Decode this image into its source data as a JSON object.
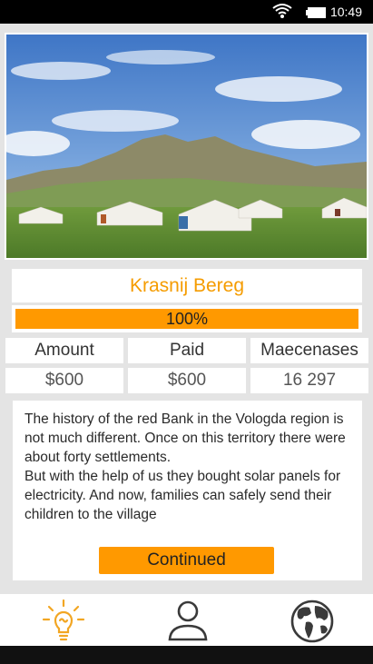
{
  "status_bar": {
    "time": "10:49",
    "icons": [
      "wifi-icon",
      "battery-icon"
    ]
  },
  "project": {
    "image": "landscape-photo-yurts",
    "title": "Krasnij Bereg",
    "progress": {
      "percent": 100,
      "label": "100%"
    },
    "stats": {
      "headers": [
        "Amount",
        "Paid",
        "Maecenases"
      ],
      "values": [
        "$600",
        "$600",
        "16 297"
      ]
    },
    "description": [
      "The history of the red Bank in the Vologda region is not much different. Once on this territory there were about forty settlements.",
      "But with the help of us they bought solar panels for electricity. And now, families can safely send their children to the village"
    ],
    "action_label": "Continued"
  },
  "tab_bar": {
    "tabs": [
      {
        "icon": "lightbulb-icon",
        "active": true
      },
      {
        "icon": "user-icon",
        "active": false
      },
      {
        "icon": "globe-icon",
        "active": false
      }
    ]
  },
  "colors": {
    "accent": "#ff9900",
    "title_text": "#f59c00",
    "background": "#e4e4e4"
  }
}
